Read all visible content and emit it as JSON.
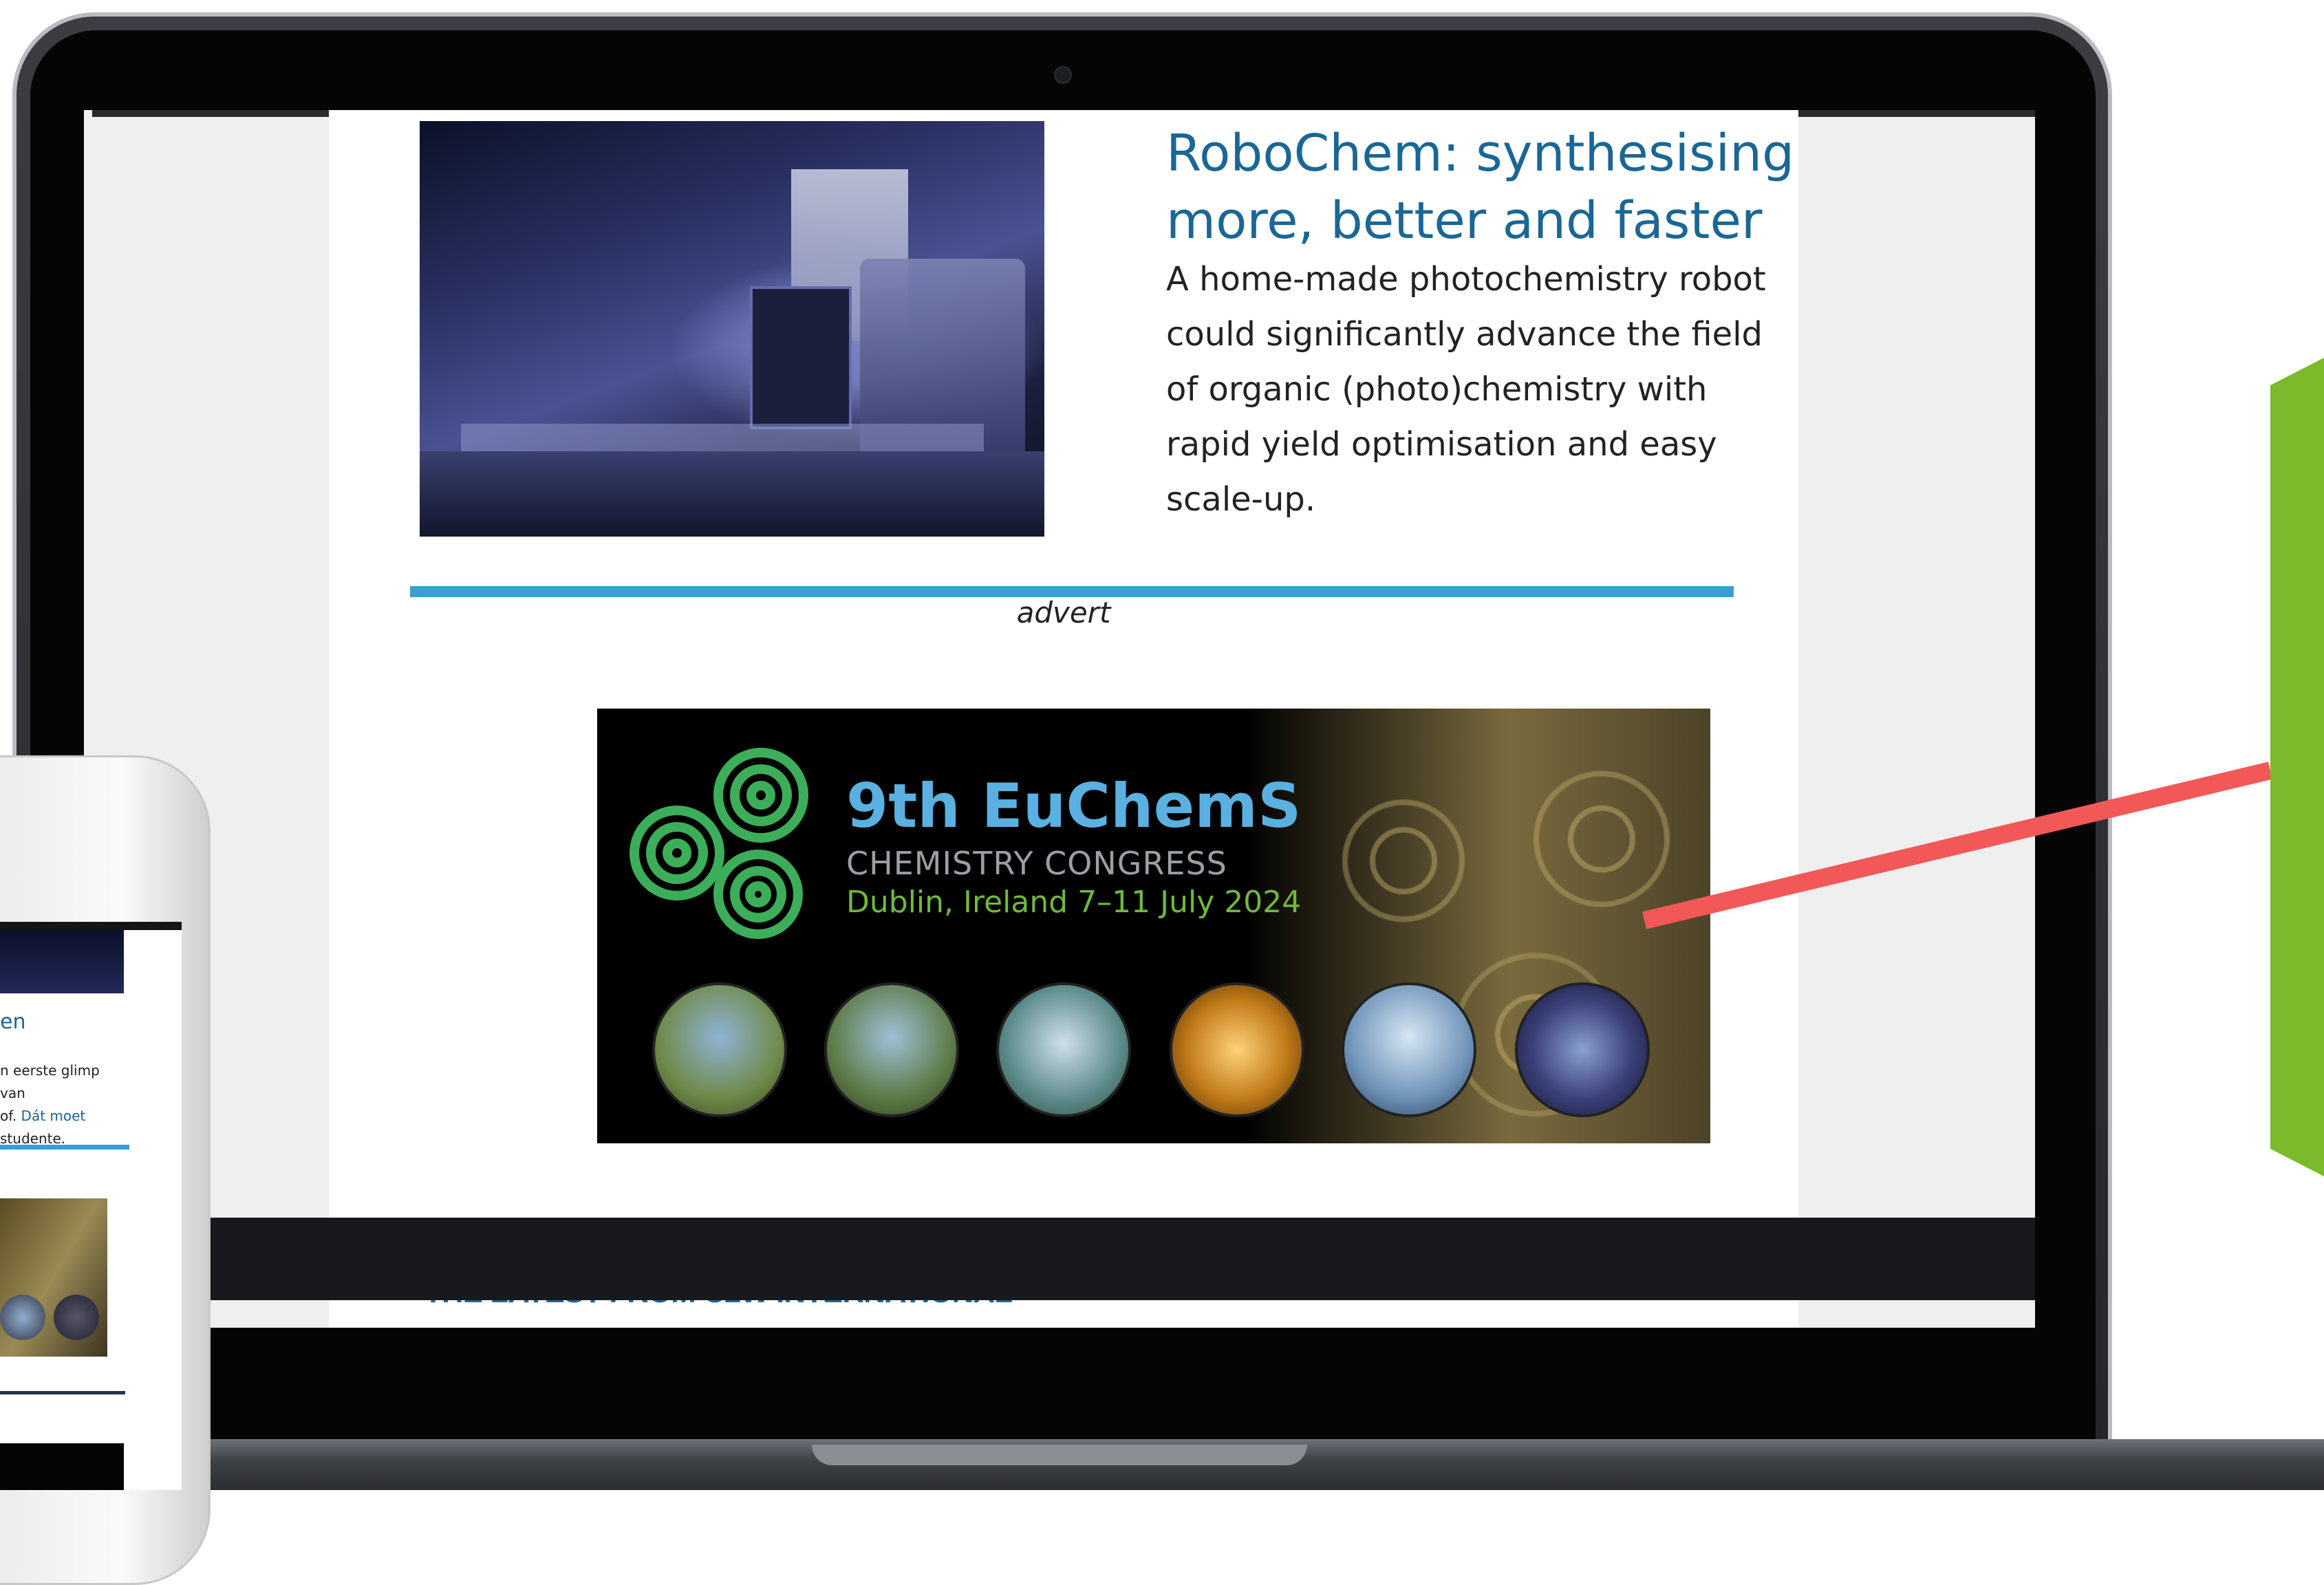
{
  "article": {
    "title": "RoboChem: synthesising more, better and faster",
    "summary": "A home-made photochemistry robot could significantly advance the field of organic (photo)chemistry with rapid yield optimisation and easy scale-up."
  },
  "advert": {
    "label": "advert",
    "banner": {
      "title": "9th EuChemS",
      "subtitle": "CHEMISTRY CONGRESS",
      "location_dates": "Dublin, Ireland 7–11 July 2024"
    }
  },
  "section": {
    "heading": "THE LATEST FROM C2W INTERNATIONAL"
  },
  "phone": {
    "title_fragment": "en",
    "text_line1": "n eerste glimp van",
    "text_line2_plain": "of. ",
    "text_line2_link": "Dát moet",
    "text_line3": "studente."
  },
  "colors": {
    "link_blue": "#1a6795",
    "rule_blue": "#3a9fcd",
    "banner_title_blue": "#5ab0e0",
    "banner_green": "#71b83c",
    "pointer_red": "#f25858",
    "shape_green": "#7aba2b"
  }
}
